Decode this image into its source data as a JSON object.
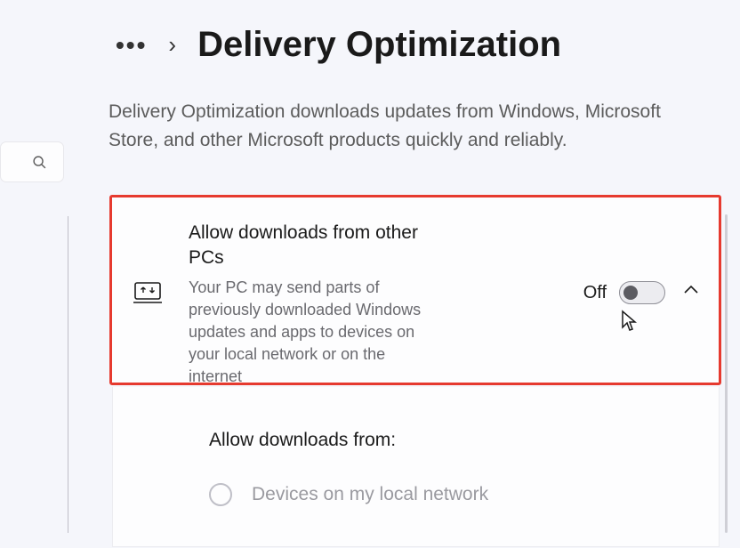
{
  "header": {
    "title": "Delivery Optimization",
    "description": "Delivery Optimization downloads updates from Windows, Microsoft Store, and other Microsoft products quickly and reliably."
  },
  "card": {
    "title": "Allow downloads from other PCs",
    "subtitle": "Your PC may send parts of previously downloaded Windows updates and apps to devices on your local network or on the internet",
    "toggle_state": "Off"
  },
  "expanded": {
    "heading": "Allow downloads from:",
    "option1": "Devices on my local network"
  }
}
